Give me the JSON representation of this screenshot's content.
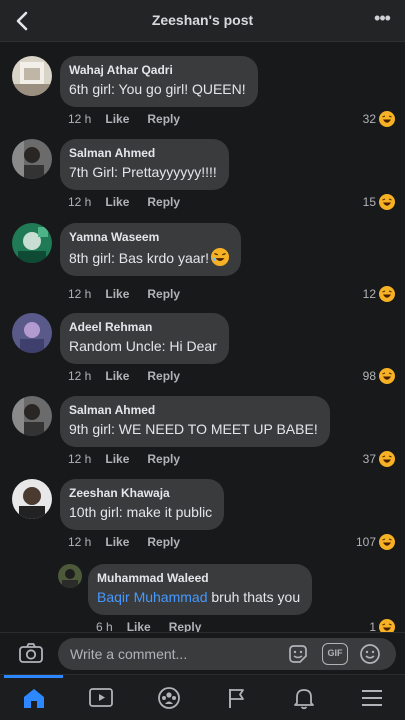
{
  "header": {
    "title": "Zeeshan's post"
  },
  "comments": [
    {
      "author": "Wahaj Athar Qadri",
      "text": "6th girl: You go girl! QUEEN!",
      "time": "12 h",
      "like": "Like",
      "reply": "Reply",
      "reactions": "32"
    },
    {
      "author": "Salman Ahmed",
      "text": "7th Girl: Prettayyyyyy!!!!",
      "time": "12 h",
      "like": "Like",
      "reply": "Reply",
      "reactions": "15"
    },
    {
      "author": "Yamna Waseem",
      "text": "8th girl: Bas krdo yaar!",
      "time": "12 h",
      "like": "Like",
      "reply": "Reply",
      "reactions": "12"
    },
    {
      "author": "Adeel Rehman",
      "text": "Random Uncle: Hi Dear",
      "time": "12 h",
      "like": "Like",
      "reply": "Reply",
      "reactions": "98"
    },
    {
      "author": "Salman Ahmed",
      "text": "9th girl: WE NEED TO MEET UP BABE!",
      "time": "12 h",
      "like": "Like",
      "reply": "Reply",
      "reactions": "37"
    },
    {
      "author": "Zeeshan Khawaja",
      "text": "10th girl: make it public",
      "time": "12 h",
      "like": "Like",
      "reply": "Reply",
      "reactions": "107"
    }
  ],
  "reply": {
    "author": "Muhammad Waleed",
    "mention": "Baqir Muhammad",
    "text": " bruh thats you",
    "time": "6 h",
    "like": "Like",
    "reply": "Reply",
    "reactions": "1"
  },
  "composer": {
    "placeholder": "Write a comment..."
  },
  "icons": {
    "reaction": "haha-emoji-icon",
    "inline_emoji": "laughing-emoji-icon",
    "gif": "GIF"
  },
  "colors": {
    "accent": "#2d88ff",
    "bubble": "#3a3b3c",
    "background": "#18191a",
    "mention": "#4599ff"
  }
}
